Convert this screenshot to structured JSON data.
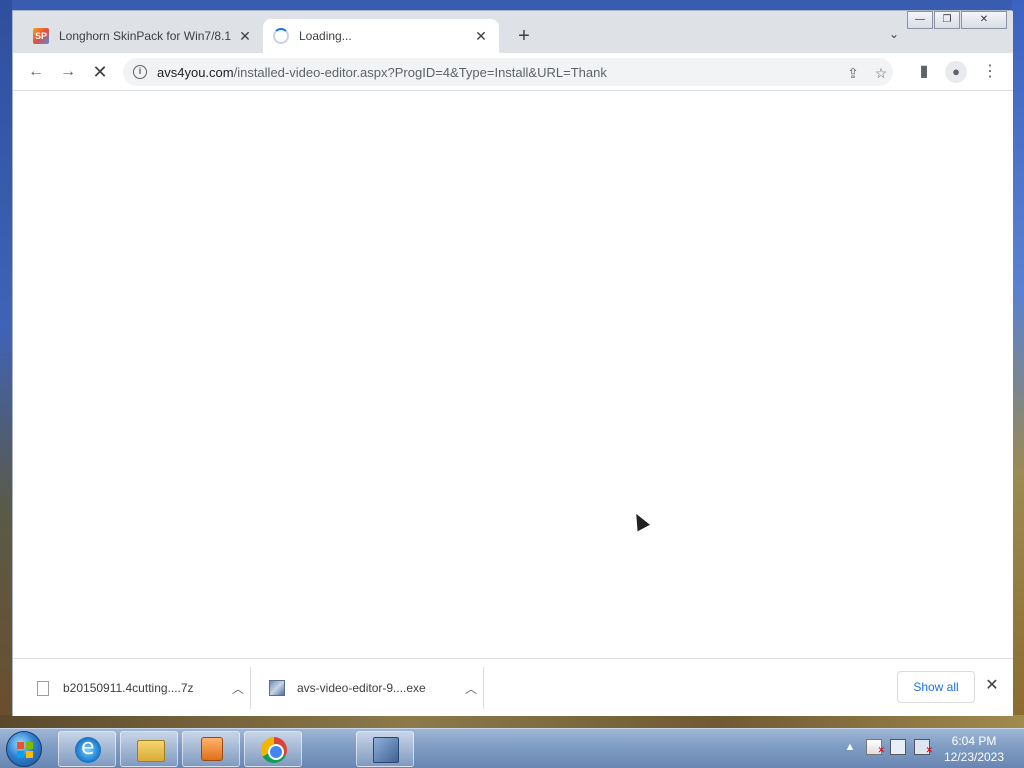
{
  "browser": {
    "tabs": [
      {
        "title": "Longhorn SkinPack for Win7/8.1",
        "favicon": "skinpack-favicon",
        "active": false
      },
      {
        "title": "Loading...",
        "favicon": "loading-spinner",
        "active": true
      }
    ],
    "new_tab_label": "+",
    "window_controls": {
      "minimize": "—",
      "restore": "❐",
      "close": "✕"
    },
    "toolbar": {
      "url_domain": "avs4you.com",
      "url_path": "/installed-video-editor.aspx?ProgID=4&Type=Install&URL=Thank"
    }
  },
  "downloads": {
    "items": [
      {
        "name": "b20150911.4cutting....7z",
        "icon": "file-icon"
      },
      {
        "name": "avs-video-editor-9....exe",
        "icon": "installer-icon"
      }
    ],
    "show_all_label": "Show all"
  },
  "taskbar": {
    "apps": [
      "internet-explorer",
      "file-explorer",
      "media-player",
      "chrome",
      "installer"
    ],
    "clock": {
      "time": "6:04 PM",
      "date": "12/23/2023"
    }
  }
}
